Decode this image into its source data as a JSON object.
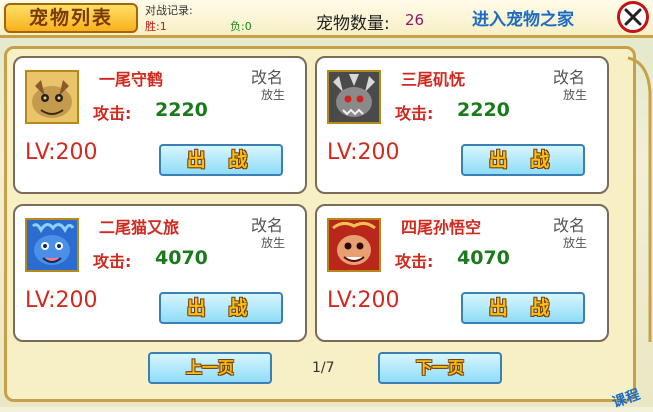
{
  "header": {
    "title": "宠物列表",
    "record_label": "对战记录:",
    "wins": "胜:1",
    "losses": "负:0",
    "pet_count_label": "宠物数量:",
    "pet_count_value": "26",
    "enter_home": "进入宠物之家"
  },
  "pets": [
    {
      "name": "一尾守鹤",
      "rename": "改名",
      "release": "放生",
      "attack_label": "攻击:",
      "attack": "2220",
      "level": "LV:200",
      "fight": "出 战",
      "icon": "sand-tanuki-icon"
    },
    {
      "name": "三尾矶怃",
      "rename": "改名",
      "release": "放生",
      "attack_label": "攻击:",
      "attack": "2220",
      "level": "LV:200",
      "fight": "出 战",
      "icon": "turtle-beast-icon"
    },
    {
      "name": "二尾猫又旅",
      "rename": "改名",
      "release": "放生",
      "attack_label": "攻击:",
      "attack": "4070",
      "level": "LV:200",
      "fight": "出 战",
      "icon": "blue-cat-icon"
    },
    {
      "name": "四尾孙悟空",
      "rename": "改名",
      "release": "放生",
      "attack_label": "攻击:",
      "attack": "4070",
      "level": "LV:200",
      "fight": "出 战",
      "icon": "red-ape-icon"
    }
  ],
  "pagination": {
    "prev": "上一页",
    "next": "下一页",
    "indicator": "1/7"
  },
  "corner_text": "课程",
  "colors": {
    "accent_red": "#d2291f",
    "attack_green": "#1b7a1b",
    "link_blue": "#1e6cc2",
    "button_fill": "#8fdcf7",
    "title_gold": "#f7b21c"
  }
}
